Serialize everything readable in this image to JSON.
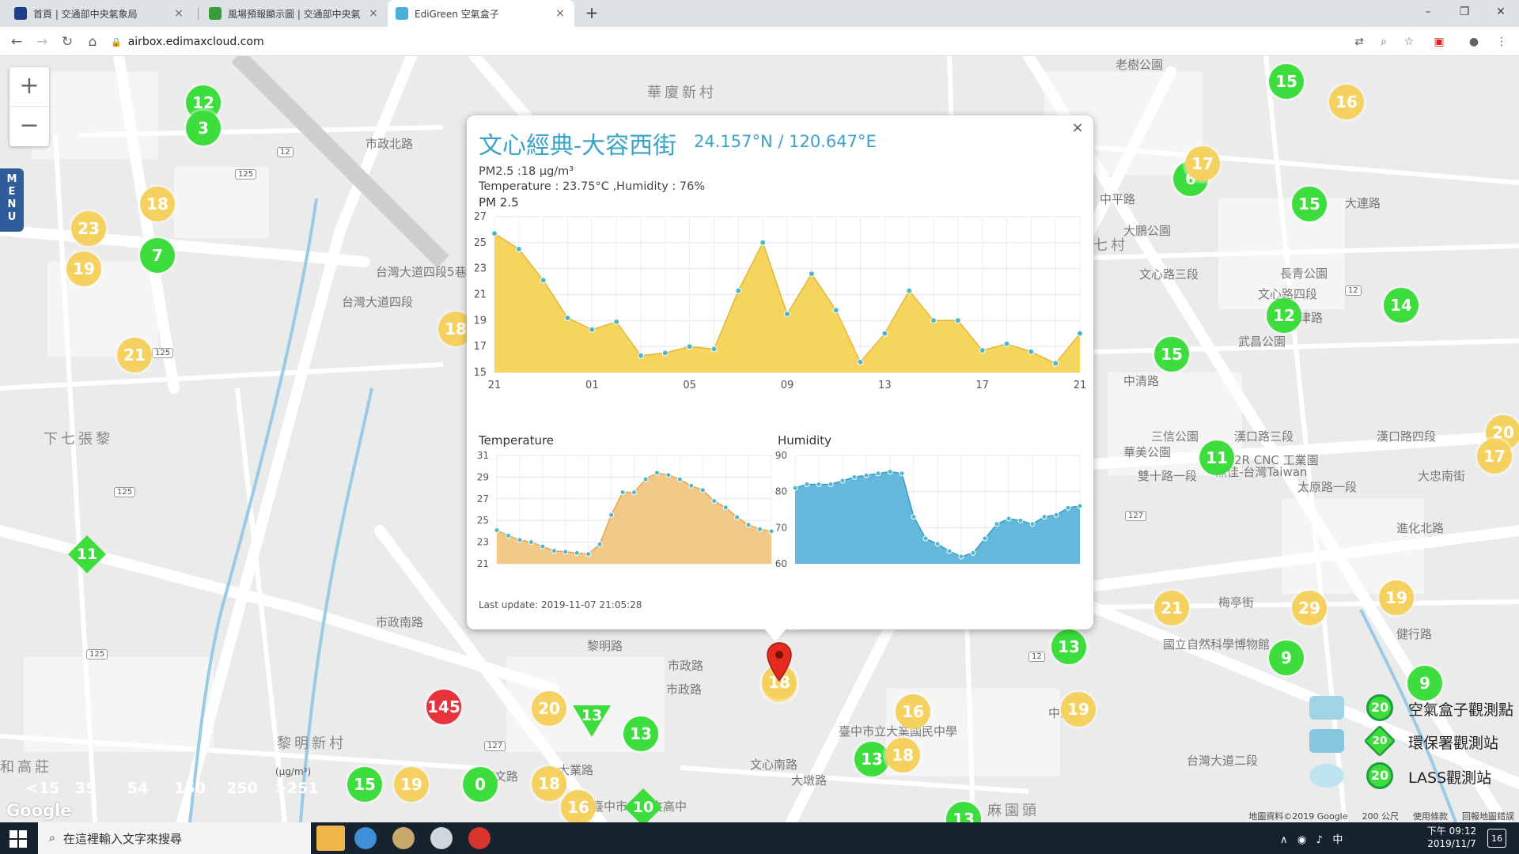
{
  "browser": {
    "tabs": [
      {
        "label": "首頁 | 交通部中央氣象局",
        "active": false
      },
      {
        "label": "風場預報顯示圖 | 交通部中央氣",
        "active": false
      },
      {
        "label": "EdiGreen 空氣盒子",
        "active": true
      }
    ],
    "url": "airbox.edimaxcloud.com"
  },
  "map": {
    "zoom_in": "+",
    "zoom_out": "−",
    "menu_label": "MENU",
    "place_labels": [
      "華廈新村",
      "下七張黎",
      "黎明新村",
      "和高莊",
      "老樹公園",
      "大鵬公園",
      "中平路",
      "武昌公園",
      "三信公園",
      "華美公園",
      "國立自然科學博物館",
      "臺中市立惠文高中",
      "臺中市立大業國民中學",
      "大業路",
      "市政北路",
      "市政南路",
      "黎明路",
      "文心南路",
      "文心路四段",
      "大連路",
      "天津路",
      "健行路",
      "梅亭街",
      "進化北路",
      "大忠南街",
      "雙十路一段",
      "漢口路四段",
      "漢口路三段",
      "市政路",
      "文心路三段",
      "長青公園",
      "台灣大道四段",
      "台灣大道二段",
      "市政路",
      "惠文路",
      "大墩路",
      "麻園頭",
      "中港路",
      "2R CNC 工業園",
      "鼎佳-台灣Taiwan",
      "太原路一段",
      "台灣大道四段5巷",
      "七村",
      "中清路"
    ],
    "route_shields": [
      "12",
      "125",
      "125",
      "127",
      "125",
      "125",
      "12",
      "127",
      "12"
    ],
    "markers": [
      {
        "v": "12",
        "c": "g"
      },
      {
        "v": "3",
        "c": "g"
      },
      {
        "v": "18",
        "c": "y"
      },
      {
        "v": "23",
        "c": "y"
      },
      {
        "v": "19",
        "c": "y"
      },
      {
        "v": "7",
        "c": "g"
      },
      {
        "v": "21",
        "c": "y"
      },
      {
        "v": "18",
        "c": "y"
      },
      {
        "v": "15",
        "c": "g"
      },
      {
        "v": "16",
        "c": "y"
      },
      {
        "v": "6",
        "c": "g"
      },
      {
        "v": "17",
        "c": "y"
      },
      {
        "v": "15",
        "c": "g"
      },
      {
        "v": "12",
        "c": "g"
      },
      {
        "v": "14",
        "c": "g"
      },
      {
        "v": "15",
        "c": "g"
      },
      {
        "v": "11",
        "c": "g"
      },
      {
        "v": "20",
        "c": "y"
      },
      {
        "v": "17",
        "c": "y"
      },
      {
        "v": "21",
        "c": "y"
      },
      {
        "v": "29",
        "c": "y"
      },
      {
        "v": "19",
        "c": "y"
      },
      {
        "v": "9",
        "c": "g"
      },
      {
        "v": "9",
        "c": "g"
      },
      {
        "v": "13",
        "c": "g"
      },
      {
        "v": "16",
        "c": "y"
      },
      {
        "v": "19",
        "c": "y"
      },
      {
        "v": "13",
        "c": "g"
      },
      {
        "v": "18",
        "c": "y"
      },
      {
        "v": "13",
        "c": "g"
      },
      {
        "v": "145",
        "c": "r"
      },
      {
        "v": "20",
        "c": "y"
      },
      {
        "v": "13",
        "c": "g"
      },
      {
        "v": "15",
        "c": "g"
      },
      {
        "v": "19",
        "c": "y"
      },
      {
        "v": "0",
        "c": "g"
      },
      {
        "v": "18",
        "c": "y"
      },
      {
        "v": "16",
        "c": "y"
      },
      {
        "v": "18",
        "c": "y"
      }
    ],
    "diamond_markers": [
      "11",
      "10"
    ],
    "triangle_markers": [
      "13"
    ],
    "selected_marker": "18",
    "aqi_legend": {
      "unit": "(μg/m³)",
      "items": [
        {
          "label": "<15",
          "color": "#3ddd3d"
        },
        {
          "label": "35",
          "color": "#f2e34a"
        },
        {
          "label": "54",
          "color": "#f5a623"
        },
        {
          "label": "150",
          "color": "#e8202a"
        },
        {
          "label": "250",
          "color": "#b81fd8"
        },
        {
          "label": ">251",
          "color": "#8a1020"
        }
      ]
    },
    "type_legend": [
      {
        "icon": "airbox-icon",
        "badge": "20",
        "label": "空氣盒子觀測點"
      },
      {
        "icon": "epa-station-icon",
        "badge": "20",
        "label": "環保署觀測站"
      },
      {
        "icon": "lass-station-icon",
        "badge": "20",
        "label": "LASS觀測站"
      }
    ],
    "google_logo": "Google",
    "footer": {
      "map_data": "地圖資料©2019 Google",
      "scale": "200 公尺",
      "terms": "使用條款",
      "report": "回報地圖錯誤"
    }
  },
  "popup": {
    "close": "×",
    "title": "文心經典-大容西街",
    "coords": "24.157°N / 120.647°E",
    "pm25_line": "PM2.5 :18 μg/m³",
    "env_line": "Temperature : 23.75°C ,Humidity : 76%",
    "pm_chart_title": "PM 2.5",
    "temp_chart_title": "Temperature",
    "hum_chart_title": "Humidity",
    "last_update": "Last update: 2019-11-07 21:05:28"
  },
  "chart_data": [
    {
      "type": "area",
      "title": "PM 2.5",
      "x_tick_labels": [
        "21",
        "01",
        "05",
        "09",
        "13",
        "17",
        "21"
      ],
      "y_ticks": [
        15,
        17,
        19,
        21,
        23,
        25,
        27
      ],
      "ylim": [
        15,
        27
      ],
      "color": "#f6d55f",
      "values": [
        25.7,
        24.5,
        22.1,
        19.2,
        18.3,
        18.9,
        16.3,
        16.5,
        17.0,
        16.8,
        21.3,
        25.0,
        19.5,
        22.6,
        19.8,
        15.8,
        18.0,
        21.3,
        19.0,
        19.0,
        16.7,
        17.2,
        16.6,
        15.7,
        18.0
      ]
    },
    {
      "type": "area",
      "title": "Temperature",
      "y_ticks": [
        21,
        23,
        25,
        27,
        29,
        31
      ],
      "ylim": [
        21,
        31
      ],
      "color": "#f3c98a",
      "values": [
        24.1,
        23.6,
        23.2,
        23.0,
        22.6,
        22.2,
        22.1,
        22.0,
        21.9,
        22.8,
        25.5,
        27.6,
        27.6,
        28.8,
        29.4,
        29.2,
        28.8,
        28.2,
        27.8,
        26.8,
        26.2,
        25.3,
        24.6,
        24.2,
        24.0
      ]
    },
    {
      "type": "area",
      "title": "Humidity",
      "y_ticks": [
        60,
        70,
        80,
        90
      ],
      "ylim": [
        60,
        90
      ],
      "color": "#63b8dc",
      "values": [
        81.0,
        82.0,
        82.0,
        82.0,
        83.0,
        84.0,
        84.5,
        85.0,
        85.5,
        85.0,
        73.0,
        67.0,
        65.5,
        63.5,
        62.0,
        63.0,
        67.0,
        71.0,
        72.5,
        72.0,
        71.0,
        73.0,
        73.5,
        75.5,
        76.0
      ]
    }
  ],
  "taskbar": {
    "search_placeholder": "在這裡輸入文字來搜尋",
    "clock_time": "下午 09:12",
    "clock_date": "2019/11/7",
    "ime": "中",
    "notif_count": "16"
  }
}
